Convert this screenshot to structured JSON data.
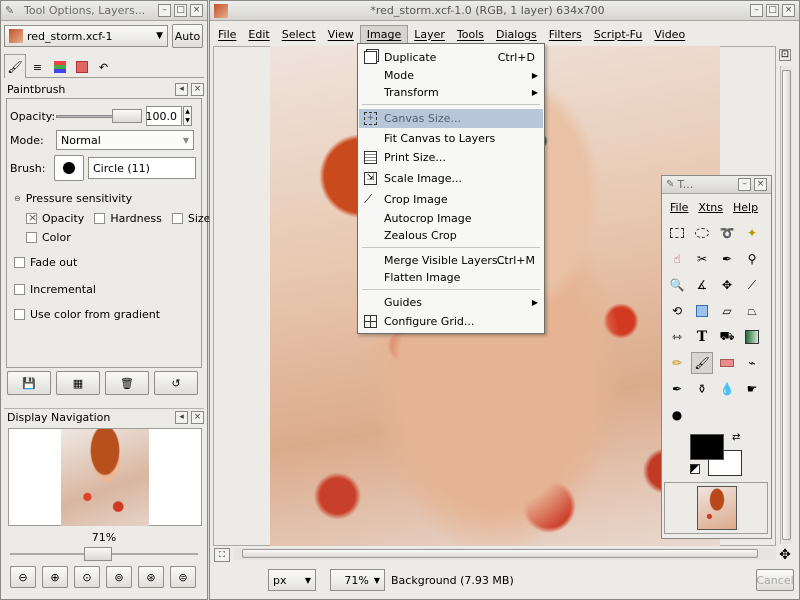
{
  "tool_window": {
    "title": "Tool Options, Layers...",
    "image_select": "red_storm.xcf-1",
    "auto_button": "Auto",
    "panel_title": "Paintbrush",
    "opacity_label": "Opacity:",
    "opacity_value": "100.0",
    "mode_label": "Mode:",
    "mode_value": "Normal",
    "brush_label": "Brush:",
    "brush_name": "Circle (11)",
    "pressure_label": "Pressure sensitivity",
    "opacity_check": "Opacity",
    "hardness_check": "Hardness",
    "size_check": "Size",
    "color_check": "Color",
    "fade_out": "Fade out",
    "incremental": "Incremental",
    "use_color_gradient": "Use color from gradient",
    "nav_title": "Display Navigation",
    "nav_zoom": "71%"
  },
  "image_window": {
    "title": "*red_storm.xcf-1.0 (RGB, 1 layer) 634x700",
    "menu": [
      "File",
      "Edit",
      "Select",
      "View",
      "Image",
      "Layer",
      "Tools",
      "Dialogs",
      "Filters",
      "Script-Fu",
      "Video"
    ],
    "unit": "px",
    "zoom": "71%",
    "status": "Background (7.93 MB)",
    "cancel": "Cancel"
  },
  "image_menu": {
    "items": [
      {
        "label": "Duplicate",
        "accel": "Ctrl+D",
        "icon": "duplicate-icon"
      },
      {
        "label": "Mode",
        "submenu": "▶"
      },
      {
        "label": "Transform",
        "submenu": "▶"
      },
      {
        "label": "Canvas Size...",
        "icon": "canvas-size-icon"
      },
      {
        "label": "Fit Canvas to Layers"
      },
      {
        "label": "Print Size...",
        "icon": "print-size-icon"
      },
      {
        "label": "Scale Image...",
        "icon": "scale-image-icon"
      },
      {
        "label": "Crop Image",
        "icon": "crop-icon"
      },
      {
        "label": "Autocrop Image"
      },
      {
        "label": "Zealous Crop"
      },
      {
        "label": "Merge Visible Layers...",
        "accel": "Ctrl+M"
      },
      {
        "label": "Flatten Image"
      },
      {
        "label": "Guides",
        "submenu": "▶"
      },
      {
        "label": "Configure Grid...",
        "icon": "grid-icon"
      }
    ]
  },
  "toolbox": {
    "title": "T...",
    "menu": [
      "File",
      "Xtns",
      "Help"
    ]
  },
  "colors": {
    "menu_highlight": "#b7c6d9",
    "foreground": "#000000",
    "background": "#ffffff"
  }
}
